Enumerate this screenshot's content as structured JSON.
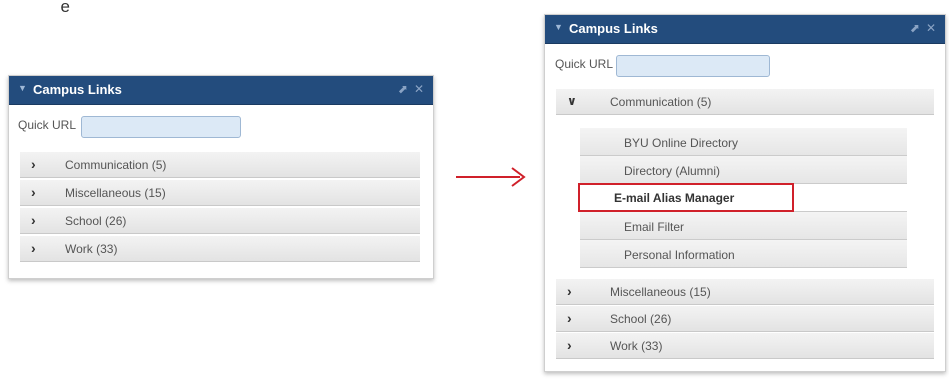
{
  "top_text": "e",
  "left_widget": {
    "title": "Campus Links",
    "quick_url_label": "Quick URL",
    "quick_url_value": "",
    "categories": [
      {
        "label": "Communication (5)"
      },
      {
        "label": "Miscellaneous (15)"
      },
      {
        "label": "School (26)"
      },
      {
        "label": "Work (33)"
      }
    ]
  },
  "right_widget": {
    "title": "Campus Links",
    "quick_url_label": "Quick URL",
    "quick_url_value": "",
    "expanded_category": {
      "label": "Communication (5)"
    },
    "sub_items": [
      {
        "label": "BYU Online Directory"
      },
      {
        "label": "Directory (Alumni)"
      },
      {
        "label": "E-mail Alias Manager"
      },
      {
        "label": "Email Filter"
      },
      {
        "label": "Personal Information"
      }
    ],
    "categories": [
      {
        "label": "Miscellaneous (15)"
      },
      {
        "label": "School (26)"
      },
      {
        "label": "Work (33)"
      }
    ]
  },
  "icons": {
    "collapse_arrow": "triangle-down-icon",
    "popout": "popout-icon",
    "close": "close-icon",
    "chevron_right": "chevron-right-icon",
    "chevron_down": "chevron-down-icon"
  },
  "colors": {
    "title_bar": "#234c7d",
    "input_fill": "#dce9f6",
    "highlight_border": "#d0202a",
    "arrow": "#d0202a"
  }
}
